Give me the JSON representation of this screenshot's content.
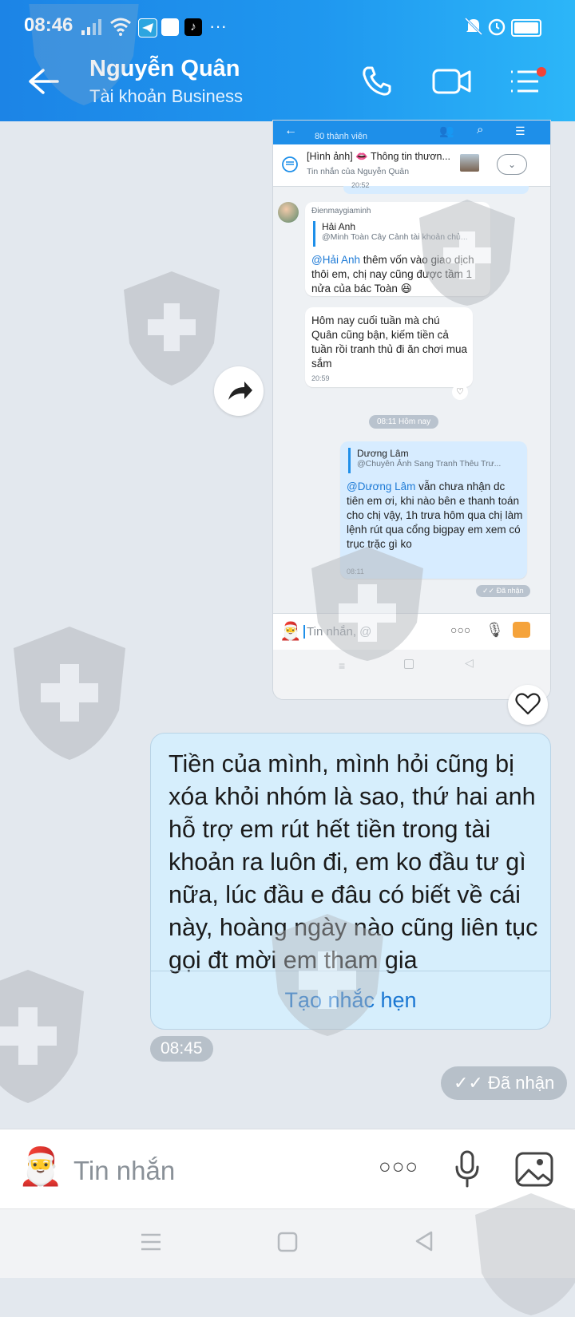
{
  "status_bar": {
    "time": "08:46",
    "notif_dots": "···"
  },
  "header": {
    "title": "Nguyễn Quân",
    "subtitle": "Tài khoản Business"
  },
  "shared_screenshot": {
    "group_members": "80 thành viên",
    "pinned": {
      "text": "[Hình ảnh] 👄 Thông tin thươn...",
      "sub": "Tin nhắn của Nguyễn Quân"
    },
    "prev_time": "20:52",
    "msg1": {
      "sender": "Đienmaygiaminh",
      "quote_name": "Hải Anh",
      "quote_text": "@Minh Toàn Cây Cảnh tài khoản chủ...",
      "mention": "@Hải Anh",
      "text": " thêm vốn vào giao dịch thôi em, chị nay cũng được tầm 1 nửa của bác Toàn 😆"
    },
    "msg2": {
      "text": "Hôm nay cuối tuần mà chú Quân cũng bận, kiếm tiền cả tuần rồi tranh thủ đi ăn chơi mua sắm",
      "time": "20:59"
    },
    "date_pill": "08:11 Hôm nay",
    "msg3": {
      "quote_name": "Dương Lâm",
      "quote_text": "@Chuyên Ảnh Sang Tranh Thêu Trư...",
      "mention": "@Dương Lâm",
      "text": " vẫn chưa nhận dc tiên em ơi, khi nào bên e thanh toán cho chị vậy, 1h trưa hôm qua chị làm lệnh rút qua cổng bigpay em xem có trục trặc gì ko",
      "time": "08:11"
    },
    "received": "Đã nhận",
    "input_placeholder": "Tin nhắn, @"
  },
  "main_message": {
    "text": "Tiền của mình, mình hỏi cũng bị xóa khỏi nhóm là sao, thứ hai anh hỗ trợ em rút hết tiền trong tài khoản ra luôn đi, em ko đầu tư gì nữa, lúc đầu e đâu có biết về cái này, hoàng ngày nào cũng liên tục gọi đt mời em tham gia",
    "reminder_label": "Tạo nhắc hẹn",
    "time": "08:45"
  },
  "received_label": "Đã nhận",
  "input": {
    "placeholder": "Tin nhắn",
    "more_dots": "○○○"
  },
  "colors": {
    "header_start": "#1c84e6",
    "header_end": "#2cb6f8",
    "bubble_sent": "#d6eefc",
    "link": "#1976d2",
    "thread_bg": "#e3e8ee"
  }
}
